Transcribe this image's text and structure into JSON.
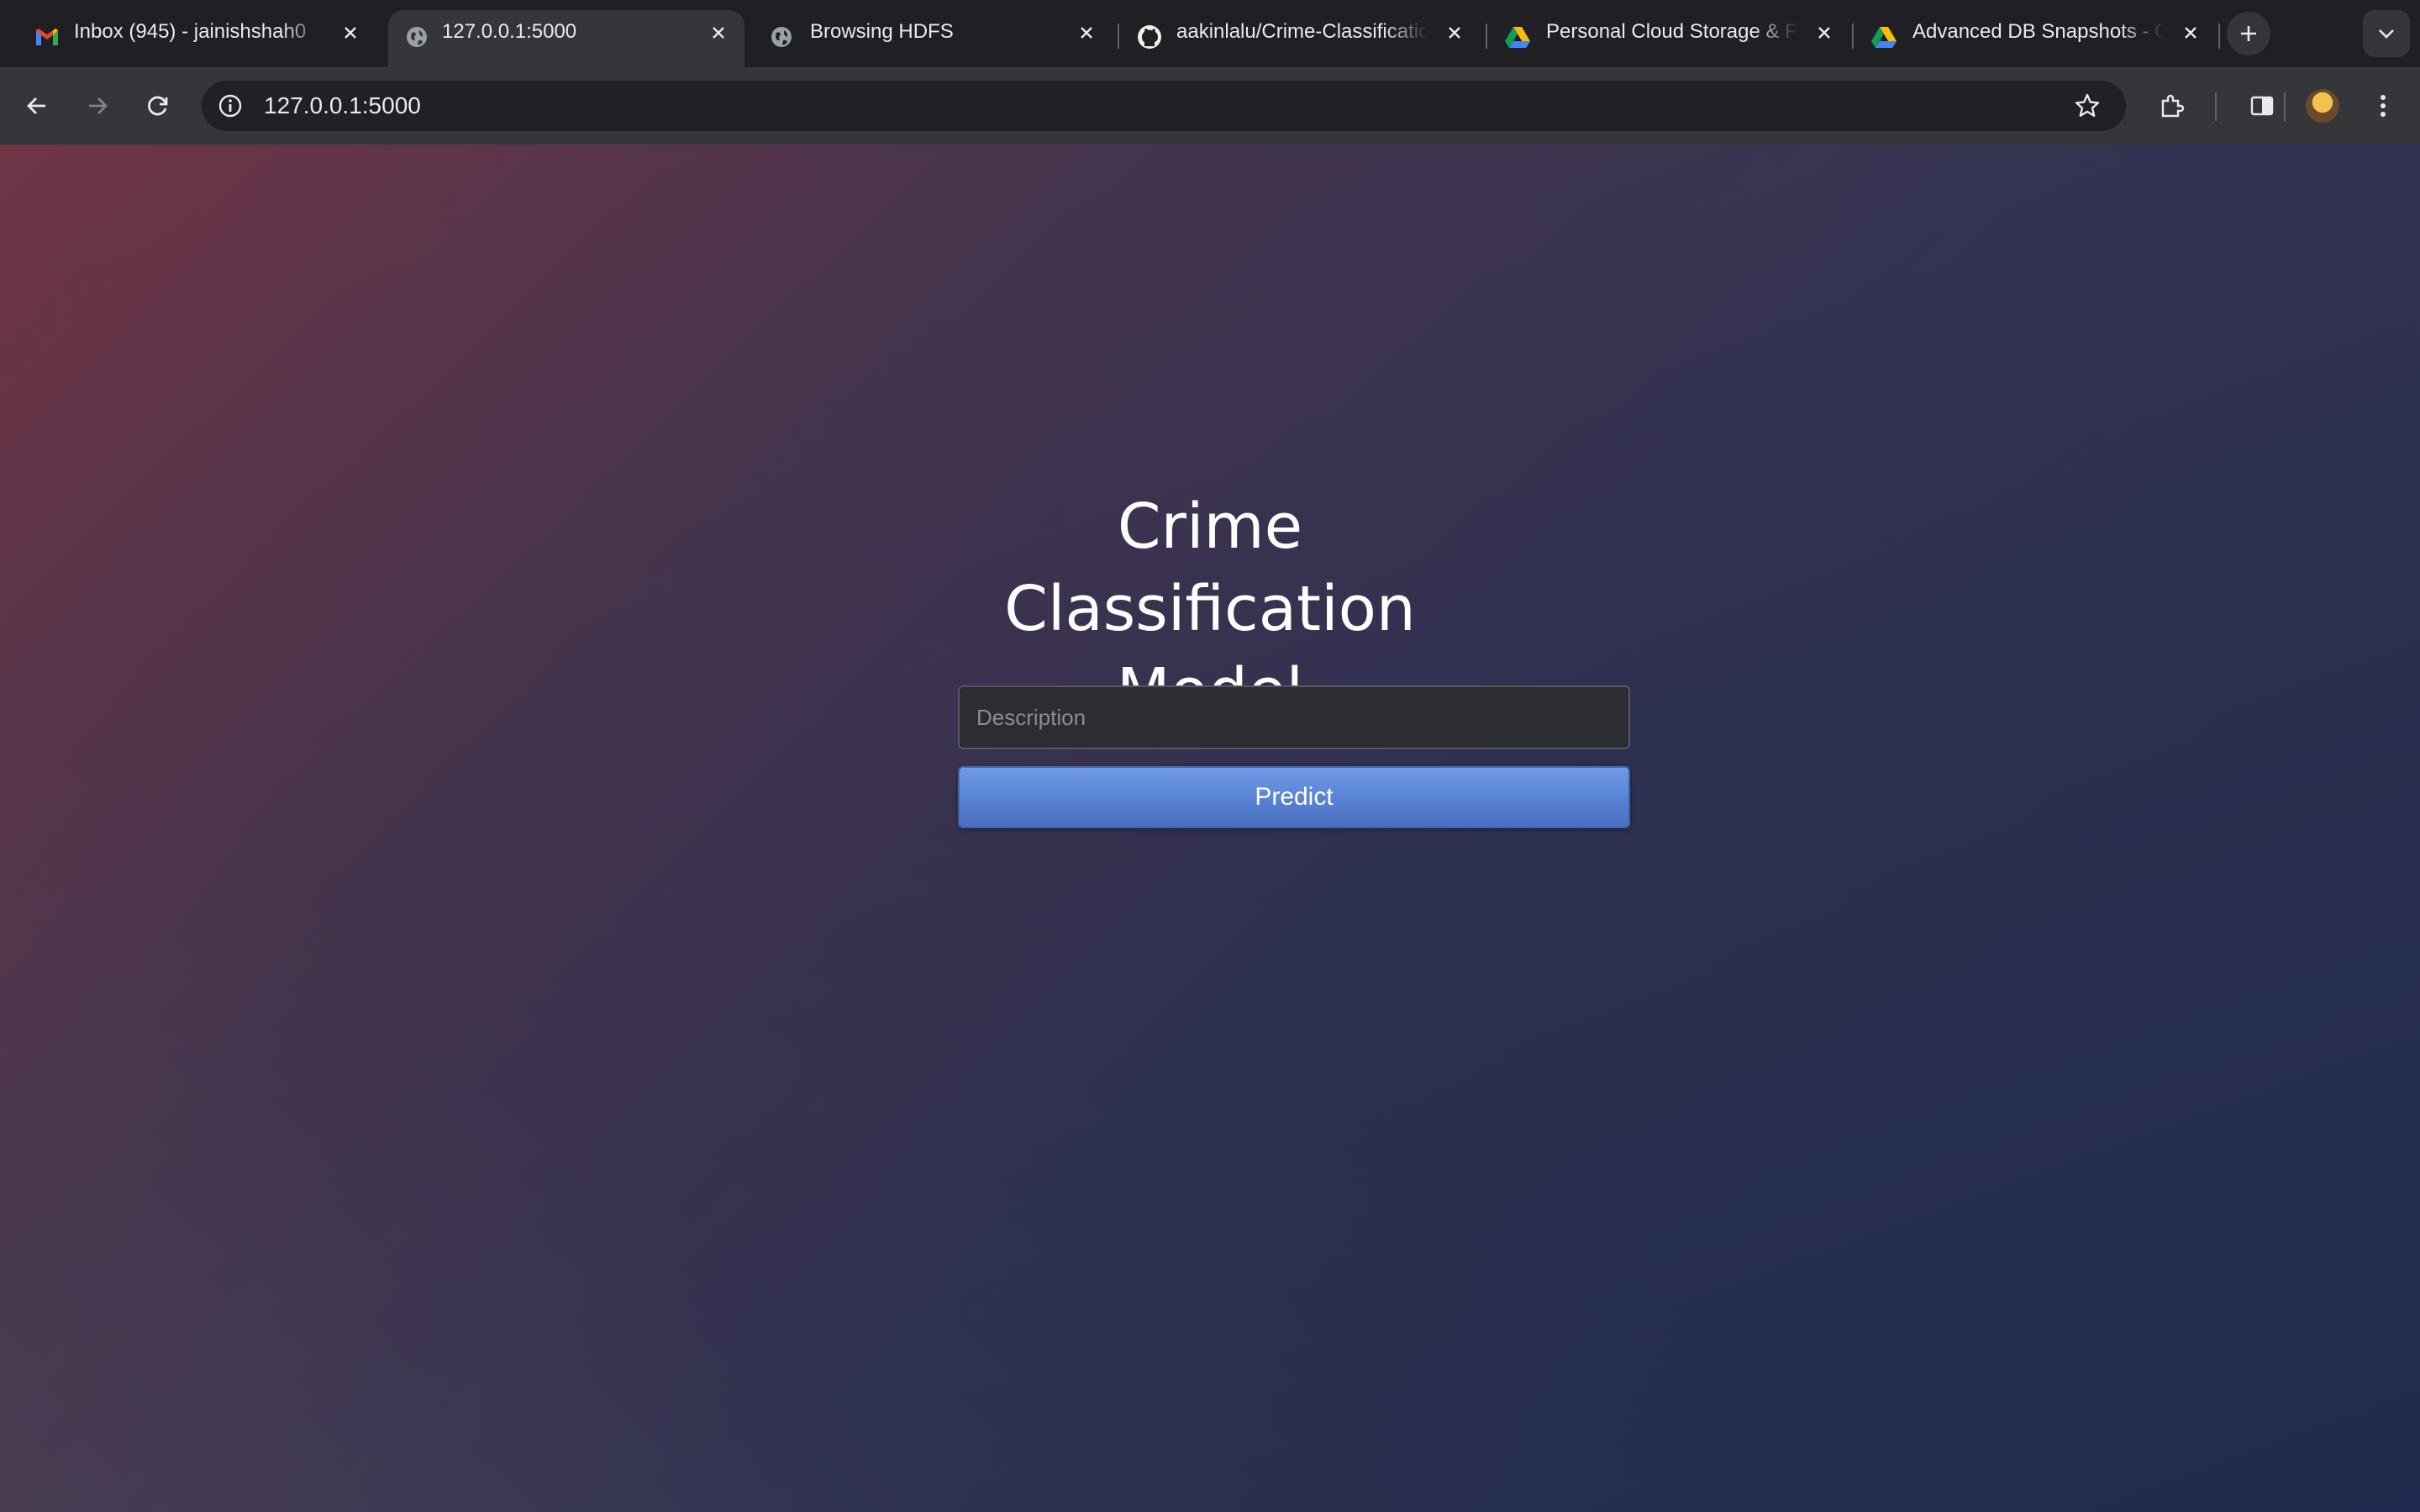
{
  "browser": {
    "tabs": [
      {
        "title": "Inbox (945) - jainishshah0",
        "favicon": "gmail-icon",
        "active": false
      },
      {
        "title": "127.0.0.1:5000",
        "favicon": "globe-icon",
        "active": true
      },
      {
        "title": "Browsing HDFS",
        "favicon": "globe-icon",
        "active": false
      },
      {
        "title": "aakinlalu/Crime-Classification",
        "favicon": "github-icon",
        "active": false
      },
      {
        "title": "Personal Cloud Storage & File",
        "favicon": "google-drive-icon",
        "active": false
      },
      {
        "title": "Advanced DB Snapshots - Go",
        "favicon": "google-drive-icon",
        "active": false
      }
    ],
    "url": "127.0.0.1:5000",
    "colors": {
      "tabstrip": "#1f1f24",
      "toolbar": "#35363a",
      "omnibox": "#202124"
    }
  },
  "page": {
    "title_line1": "Crime Classification",
    "title_line2": "Model",
    "description_placeholder": "Description",
    "description_value": "",
    "predict_label": "Predict",
    "colors": {
      "button": "#5b84d6",
      "title": "#ffffff"
    }
  }
}
